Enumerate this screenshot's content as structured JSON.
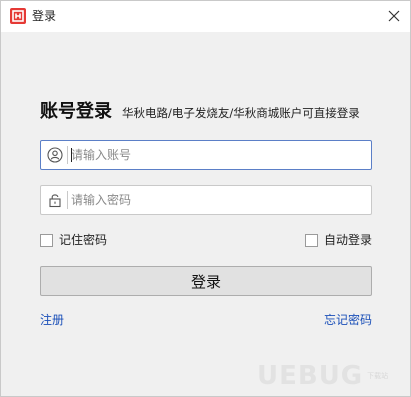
{
  "window": {
    "title": "登录",
    "close_icon": "close-icon",
    "app_icon": "app-logo-icon",
    "brand_color": "#e53935"
  },
  "login": {
    "heading": "账号登录",
    "subheading": "华秋电路/电子发烧友/华秋商城账户可直接登录",
    "username_placeholder": "请输入账号",
    "username_icon": "user-icon",
    "password_placeholder": "请输入密码",
    "password_icon": "lock-icon",
    "remember_password": "记住密码",
    "auto_login": "自动登录",
    "submit": "登录",
    "register": "注册",
    "forgot_password": "忘记密码",
    "link_color": "#1a4fb8"
  },
  "watermark": {
    "text": "UEBUG",
    "sub": "下载站"
  }
}
